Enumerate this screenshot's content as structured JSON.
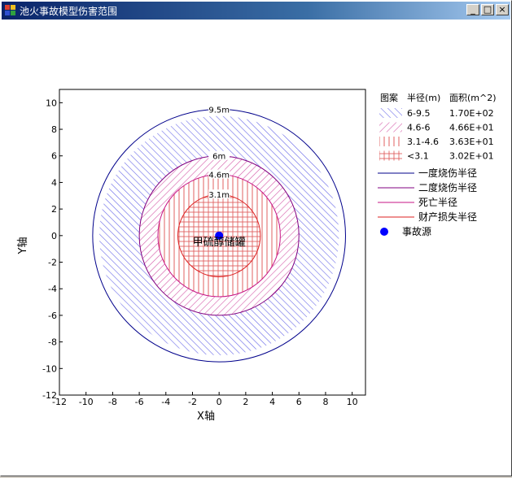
{
  "window": {
    "title": "池火事故模型伤害范围",
    "buttons": {
      "minimize": "_",
      "maximize": "□",
      "close": "×"
    }
  },
  "colors": {
    "blue": "#00008b",
    "purple": "#800080",
    "magenta": "#c71585",
    "red": "#dd2222",
    "hatch_blue": "#6a6ae8",
    "hatch_magenta": "#d45aa8",
    "hatch_red": "#e06060"
  },
  "chart_data": {
    "type": "scatter",
    "xlabel": "X轴",
    "ylabel": "Y轴",
    "xlim": [
      -12,
      11
    ],
    "ylim": [
      -12,
      11
    ],
    "xticks": [
      -12,
      -10,
      -8,
      -6,
      -4,
      -2,
      0,
      2,
      4,
      6,
      8,
      10
    ],
    "yticks": [
      -12,
      -10,
      -8,
      -6,
      -4,
      -2,
      0,
      2,
      4,
      6,
      8,
      10
    ],
    "circles": [
      {
        "radius": 9.5,
        "label": "9.5m",
        "name": "一度烧伤半径"
      },
      {
        "radius": 6,
        "label": "6m",
        "name": "二度烧伤半径"
      },
      {
        "radius": 4.6,
        "label": "4.6m",
        "name": "死亡半径"
      },
      {
        "radius": 3.1,
        "label": "3.1m",
        "name": "财产损失半径"
      }
    ],
    "source": {
      "x": 0,
      "y": 0,
      "label": "甲硫醇储罐",
      "name": "事故源"
    },
    "legend": {
      "headers": [
        "图案",
        "半径(m)",
        "面积(m^2)"
      ],
      "zones": [
        {
          "range": "6-9.5",
          "area": "1.70E+02",
          "pattern": "hatch-blue"
        },
        {
          "range": "4.6-6",
          "area": "4.66E+01",
          "pattern": "hatch-magenta"
        },
        {
          "range": "3.1-4.6",
          "area": "3.63E+01",
          "pattern": "vlines-red"
        },
        {
          "range": "<3.1",
          "area": "3.02E+01",
          "pattern": "grid-red"
        }
      ],
      "lines": [
        {
          "label": "一度烧伤半径",
          "color": "blue"
        },
        {
          "label": "二度烧伤半径",
          "color": "purple"
        },
        {
          "label": "死亡半径",
          "color": "magenta"
        },
        {
          "label": "财产损失半径",
          "color": "red"
        }
      ],
      "source_label": "事故源"
    }
  }
}
